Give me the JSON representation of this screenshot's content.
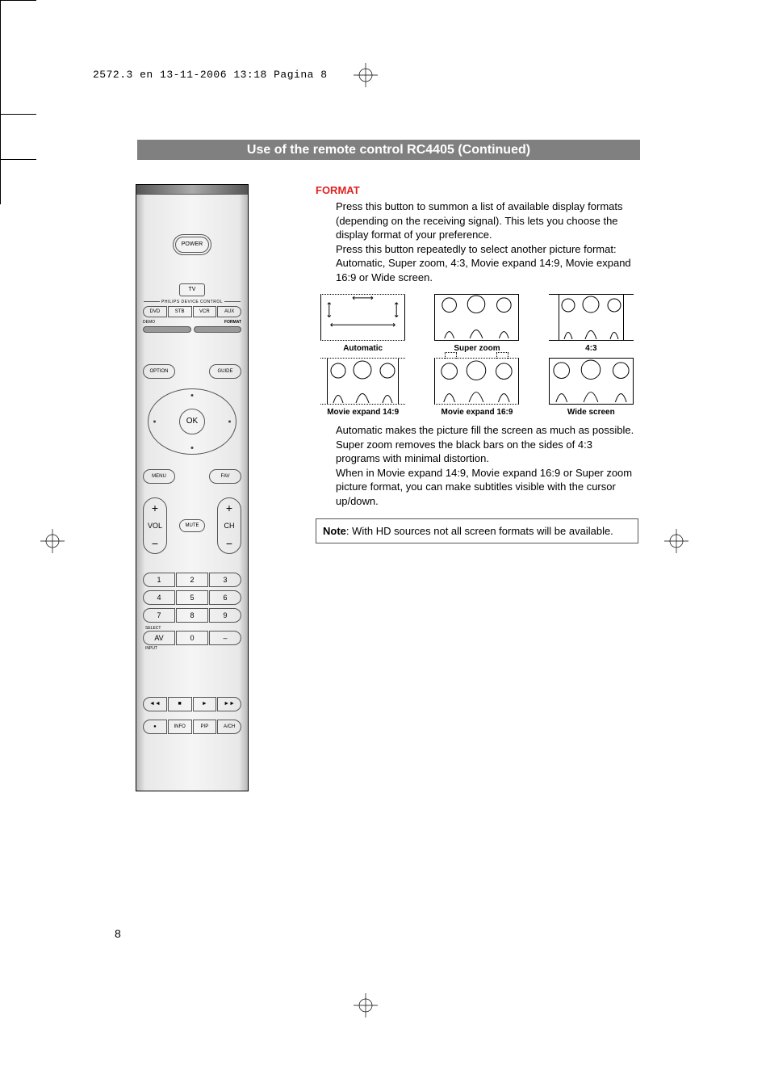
{
  "header_line": "2572.3 en  13-11-2006  13:18  Pagina 8",
  "title_bar": "Use of the remote control RC4405   (Continued)",
  "remote": {
    "power": "POWER",
    "tv": "TV",
    "device_label": "PHILIPS DEVICE CONTROL",
    "devices": [
      "DVD",
      "STB",
      "VCR",
      "AUX"
    ],
    "demo": "DEMO",
    "format": "FORMAT",
    "option": "OPTION",
    "guide": "GUIDE",
    "ok": "OK",
    "menu": "MENU",
    "fav": "FAV",
    "vol": "VOL",
    "mute": "MUTE",
    "ch": "CH",
    "numpad": [
      [
        "1",
        "2",
        "3"
      ],
      [
        "4",
        "5",
        "6"
      ],
      [
        "7",
        "8",
        "9"
      ],
      [
        "AV",
        "0",
        "–"
      ]
    ],
    "select": "SELECT",
    "input": "INPUT",
    "transport": [
      "◄◄",
      "■",
      "►",
      "►►"
    ],
    "bottom_row": [
      "●",
      "INFO",
      "PIP",
      "A/CH"
    ]
  },
  "content": {
    "heading": "FORMAT",
    "para1": "Press this button to summon a list of available display formats (depending on the receiving signal). This lets you choose the display format of your preference.",
    "para2": "Press this button repeatedly to select another picture format: Automatic, Super zoom, 4:3, Movie expand 14:9, Movie expand 16:9 or Wide screen.",
    "formats": [
      "Automatic",
      "Super zoom",
      "4:3",
      "Movie expand 14:9",
      "Movie expand 16:9",
      "Wide screen"
    ],
    "para3": "Automatic makes the picture fill the screen as much as possible.",
    "para4": "Super zoom removes the black bars on the sides of 4:3 programs with minimal distortion.",
    "para5": "When in Movie expand 14:9, Movie expand 16:9 or Super zoom picture format, you can make subtitles visible with the cursor up/down.",
    "note_label": "Note",
    "note_text": ": With HD sources not all screen formats will be available."
  },
  "page_number": "8"
}
